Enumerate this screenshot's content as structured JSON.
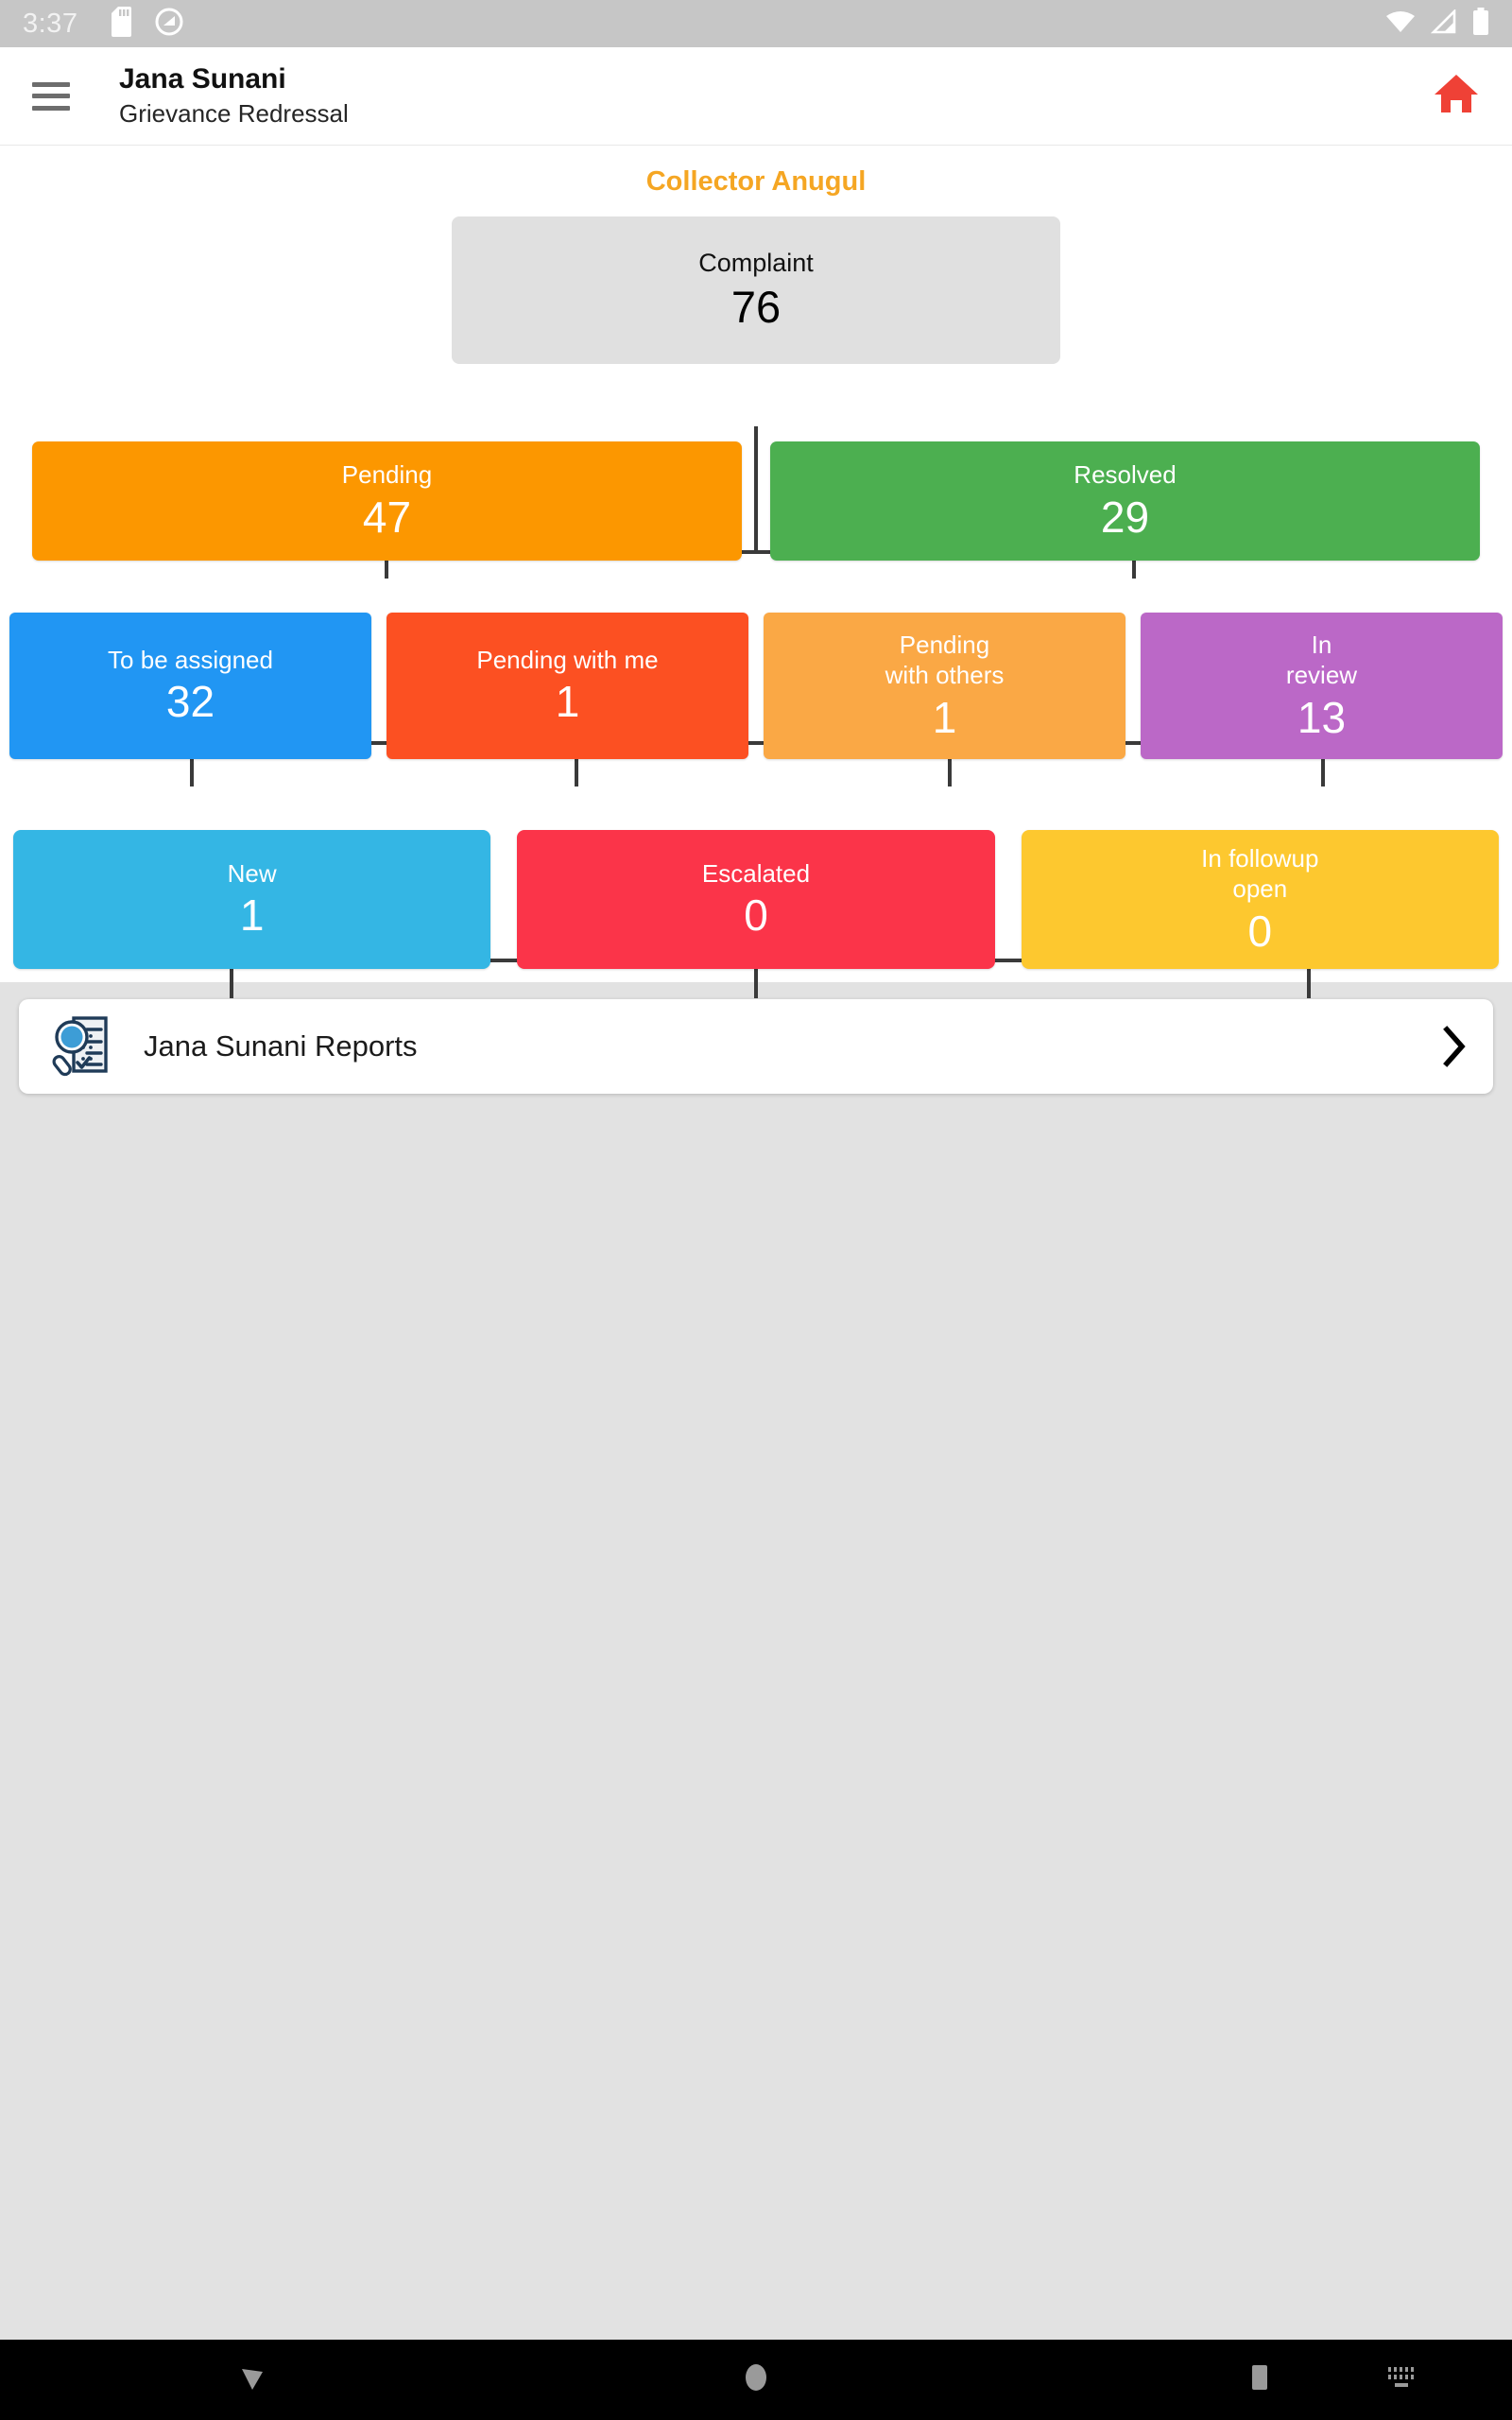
{
  "statusbar": {
    "time": "3:37",
    "icons": [
      "sd-card-icon",
      "do-not-disturb-icon",
      "wifi-icon",
      "cellular-signal-icon",
      "battery-icon"
    ]
  },
  "appbar": {
    "menu_icon": "hamburger-menu-icon",
    "title": "Jana Sunani",
    "subtitle": "Grievance Redressal",
    "home_icon": "home-icon",
    "home_icon_color": "#ef4136"
  },
  "tree": {
    "section_title": "Collector Anugul",
    "section_title_color": "#f5a623",
    "root": {
      "label": "Complaint",
      "value": "76",
      "color": "#e0e0e0",
      "text_color": "#111111"
    },
    "level2": [
      {
        "label": "Pending",
        "value": "47",
        "color": "#fc9700"
      },
      {
        "label": "Resolved",
        "value": "29",
        "color": "#4caf50"
      }
    ],
    "level3": [
      {
        "label": "To be assigned",
        "value": "32",
        "color": "#2196f3"
      },
      {
        "label": "Pending with me",
        "value": "1",
        "color": "#fc5022"
      },
      {
        "label": "Pending\nwith others",
        "value": "1",
        "color": "#faa845"
      },
      {
        "label": "In\nreview",
        "value": "13",
        "color": "#bb68c7"
      }
    ],
    "level4": [
      {
        "label": "New",
        "value": "1",
        "color": "#34b6e4"
      },
      {
        "label": "Escalated",
        "value": "0",
        "color": "#fb3449"
      },
      {
        "label": "In followup\nopen",
        "value": "0",
        "color": "#fdc82f"
      }
    ]
  },
  "reports": {
    "icon": "report-search-icon",
    "label": "Jana Sunani Reports",
    "chevron_icon": "chevron-right-icon"
  },
  "navbar": {
    "back_icon": "back-triangle-icon",
    "home_icon": "home-circle-icon",
    "recents_icon": "recents-square-icon",
    "keyboard_icon": "keyboard-icon"
  }
}
